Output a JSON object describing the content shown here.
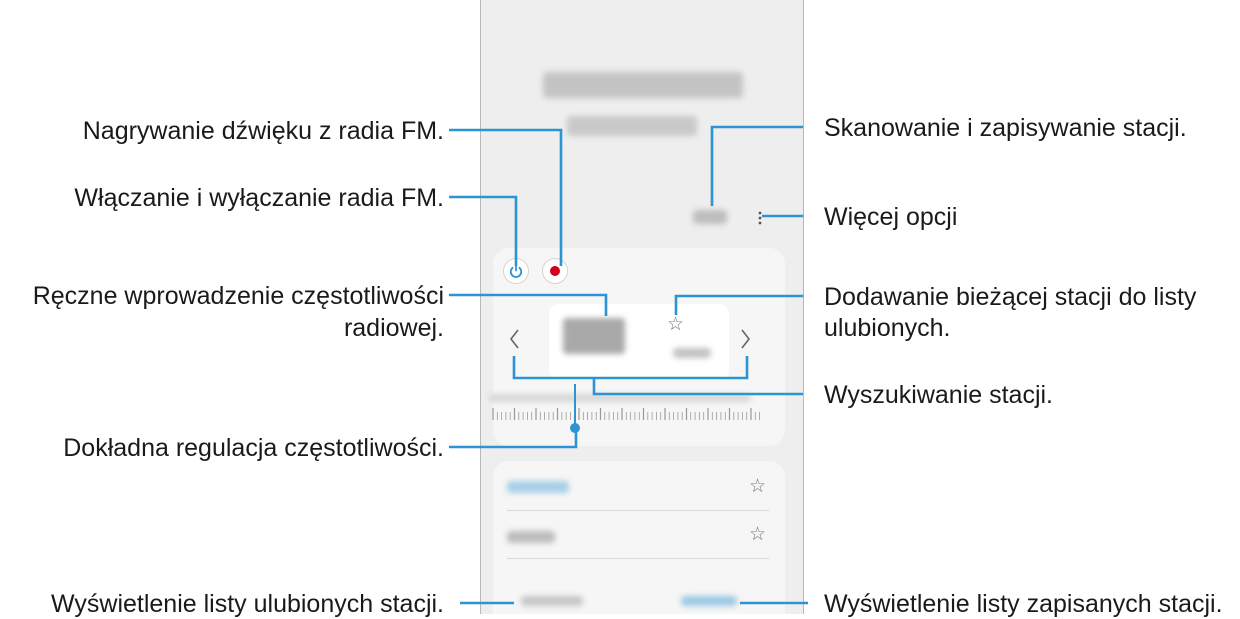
{
  "annotations": {
    "record": "Nagrywanie dźwięku z radia FM.",
    "power": "Włączanie i wyłączanie radia FM.",
    "manual_line1": "Ręczne wprowadzenie częstotliwości",
    "manual_line2": "radiowej.",
    "fine_tune": "Dokładna regulacja częstotliwości.",
    "favorites_list": "Wyświetlenie listy ulubionych stacji.",
    "scan": "Skanowanie i zapisywanie stacji.",
    "more": "Więcej opcji",
    "add_fav_line1": "Dodawanie bieżącej stacji do listy",
    "add_fav_line2": "ulubionych.",
    "search": "Wyszukiwanie stacji.",
    "saved_list": "Wyświetlenie listy zapisanych stacji."
  },
  "colors": {
    "callout": "#2c94d3",
    "record_dot": "#d0021b",
    "power_icon": "#2c94d3",
    "tuner_knob": "#2c94d3",
    "phone_bg": "#eeeeee",
    "card_bg": "#f6f6f6"
  },
  "icons": {
    "power": "power-icon",
    "record": "record-icon",
    "favorite": "star-outline-icon",
    "previous": "chevron-left-icon",
    "next": "chevron-right-icon",
    "more": "more-vertical-icon"
  },
  "glyphs": {
    "star": "☆",
    "chevron_left": "‹",
    "chevron_right": "›"
  }
}
